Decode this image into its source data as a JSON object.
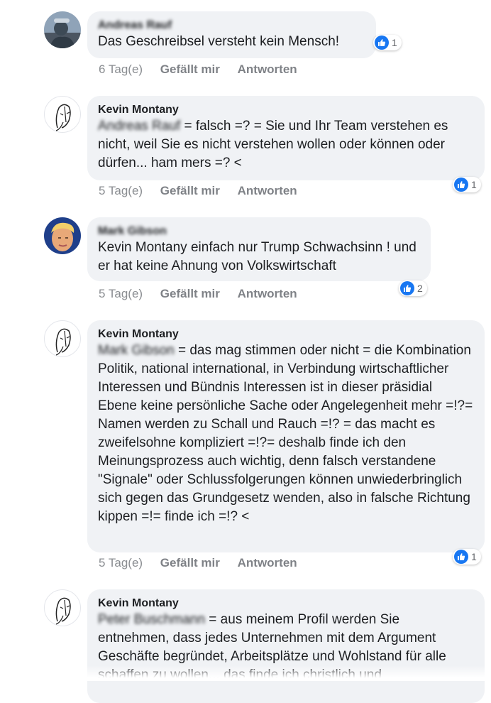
{
  "comments": [
    {
      "author": "Andreas Rauf",
      "mention": "",
      "text": "Das Geschreibsel versteht kein Mensch!",
      "time": "6 Tag(e)",
      "like": "Gefällt mir",
      "reply": "Antworten",
      "reactions": "1",
      "avatar": "photo-avatar"
    },
    {
      "author": "Kevin Montany",
      "mention": "Andreas Rauf",
      "text": " = falsch =? = Sie und Ihr Team verstehen es nicht, weil Sie es nicht verstehen wollen oder können oder dürfen... ham mers =? <",
      "time": "5 Tag(e)",
      "like": "Gefällt mir",
      "reply": "Antworten",
      "reactions": "1",
      "avatar": "sketch-face-avatar"
    },
    {
      "author": "Mark Gibson",
      "mention": "",
      "text": "Kevin Montany einfach nur Trump Schwachsinn ! und er hat keine Ahnung von Volkswirtschaft",
      "time": "5 Tag(e)",
      "like": "Gefällt mir",
      "reply": "Antworten",
      "reactions": "2",
      "avatar": "photo-avatar"
    },
    {
      "author": "Kevin Montany",
      "mention": "Mark Gibson",
      "text": " = das mag stimmen oder nicht = die Kombination Politik, national international, in Verbindung wirtschaftlicher Interessen und Bündnis Interessen ist in dieser präsidial Ebene keine persönliche Sache oder Angelegenheit mehr =!?= Namen werden zu Schall und Rauch =!? = das macht es zweifelsohne kompliziert =!?= deshalb finde ich den Meinungsprozess auch wichtig, denn falsch verstandene \"Signale\" oder Schlussfolgerungen können unwiederbringlich sich gegen das Grundgesetz wenden, also in falsche Richtung kippen =!= finde ich =!? <",
      "time": "5 Tag(e)",
      "like": "Gefällt mir",
      "reply": "Antworten",
      "reactions": "1",
      "avatar": "sketch-face-avatar"
    },
    {
      "author": "Kevin Montany",
      "mention": "Peter Buschmann",
      "text": " = aus meinem Profil werden Sie entnehmen, dass jedes Unternehmen mit dem Argument Geschäfte begründet, Arbeitsplätze und Wohlstand für alle schaffen zu wollen... das finde ich christlich und",
      "avatar": "sketch-face-avatar"
    }
  ],
  "colors": {
    "bubble": "#f0f2f5",
    "like_blue": "#1877f2",
    "meta_gray": "#8a8d91"
  }
}
